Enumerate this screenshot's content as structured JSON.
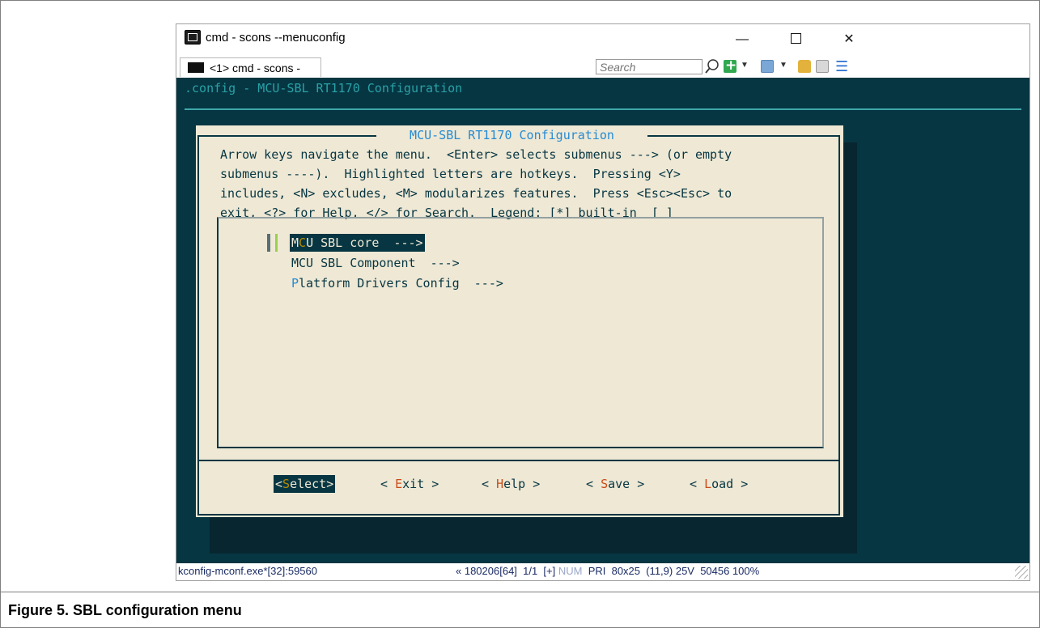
{
  "window": {
    "title": "cmd - scons  --menuconfig",
    "min_symbol": "—",
    "close_symbol": "✕"
  },
  "tabbar": {
    "tab_label": "<1> cmd - scons  -",
    "search_placeholder": "Search",
    "icons": [
      "search-icon",
      "add-console-icon",
      "panes-icon",
      "lock-icon",
      "split-icon",
      "menu-icon"
    ]
  },
  "terminal": {
    "title": ".config - MCU-SBL RT1170 Configuration",
    "dialog_title": " MCU-SBL RT1170 Configuration ",
    "help_lines": [
      "Arrow keys navigate the menu.  <Enter> selects submenus ---> (or empty",
      "submenus ----).  Highlighted letters are hotkeys.  Pressing <Y>",
      "includes, <N> excludes, <M> modularizes features.  Press <Esc><Esc> to",
      "exit, <?> for Help, </> for Search.  Legend: [*] built-in  [ ]"
    ],
    "menu_items": [
      {
        "hotkey": "C",
        "pre": "M",
        "rest": "U SBL core  --->",
        "selected": true
      },
      {
        "hotkey": "",
        "pre": "MCU SBL Component  --->",
        "rest": "",
        "selected": false
      },
      {
        "hotkey": "P",
        "pre": "",
        "rest": "latform Drivers Config  --->",
        "selected": false
      }
    ],
    "buttons": [
      {
        "pre": "<",
        "hotkey": "S",
        "rest": "elect>",
        "selected": true
      },
      {
        "pre": "< ",
        "hotkey": "E",
        "rest": "xit >",
        "selected": false
      },
      {
        "pre": "< ",
        "hotkey": "H",
        "rest": "elp >",
        "selected": false
      },
      {
        "pre": "< ",
        "hotkey": "S",
        "rest": "ave >",
        "selected": false
      },
      {
        "pre": "< ",
        "hotkey": "L",
        "rest": "oad >",
        "selected": false
      }
    ]
  },
  "statusbar": {
    "left": "kconfig-mconf.exe*[32]:59560",
    "right_pre": "« 180206[64]  1/1  [+] ",
    "num": "NUM",
    "right_post": "  PRI  80x25  (11,9) 25V  50456 100%"
  },
  "caption": "Figure 5. SBL configuration menu",
  "colors": {
    "console_bg": "#063642",
    "dialog_bg": "#eee8d5",
    "title_cyan": "#2aa1a7",
    "hotkey_blue": "#268bd2",
    "button_hotkey": "#cb4b16"
  }
}
